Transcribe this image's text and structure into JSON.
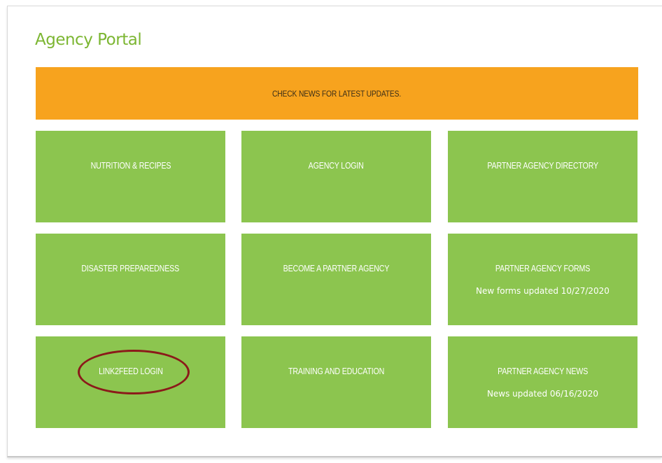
{
  "page": {
    "title": "Agency Portal"
  },
  "banner": {
    "text": "CHECK NEWS FOR LATEST UPDATES."
  },
  "tiles": [
    {
      "label": "NUTRITION & RECIPES",
      "sub": ""
    },
    {
      "label": "AGENCY LOGIN",
      "sub": ""
    },
    {
      "label": "PARTNER AGENCY DIRECTORY",
      "sub": ""
    },
    {
      "label": "DISASTER PREPAREDNESS",
      "sub": ""
    },
    {
      "label": "BECOME A PARTNER AGENCY",
      "sub": ""
    },
    {
      "label": "PARTNER AGENCY FORMS",
      "sub": "New forms updated 10/27/2020"
    },
    {
      "label": "LINK2FEED LOGIN",
      "sub": ""
    },
    {
      "label": "TRAINING AND EDUCATION",
      "sub": ""
    },
    {
      "label": "PARTNER AGENCY NEWS",
      "sub": "News updated 06/16/2020"
    }
  ],
  "colors": {
    "title": "#7cb632",
    "banner": "#f7a31e",
    "tile": "#8cc54f",
    "highlight": "#8b1a1a"
  }
}
